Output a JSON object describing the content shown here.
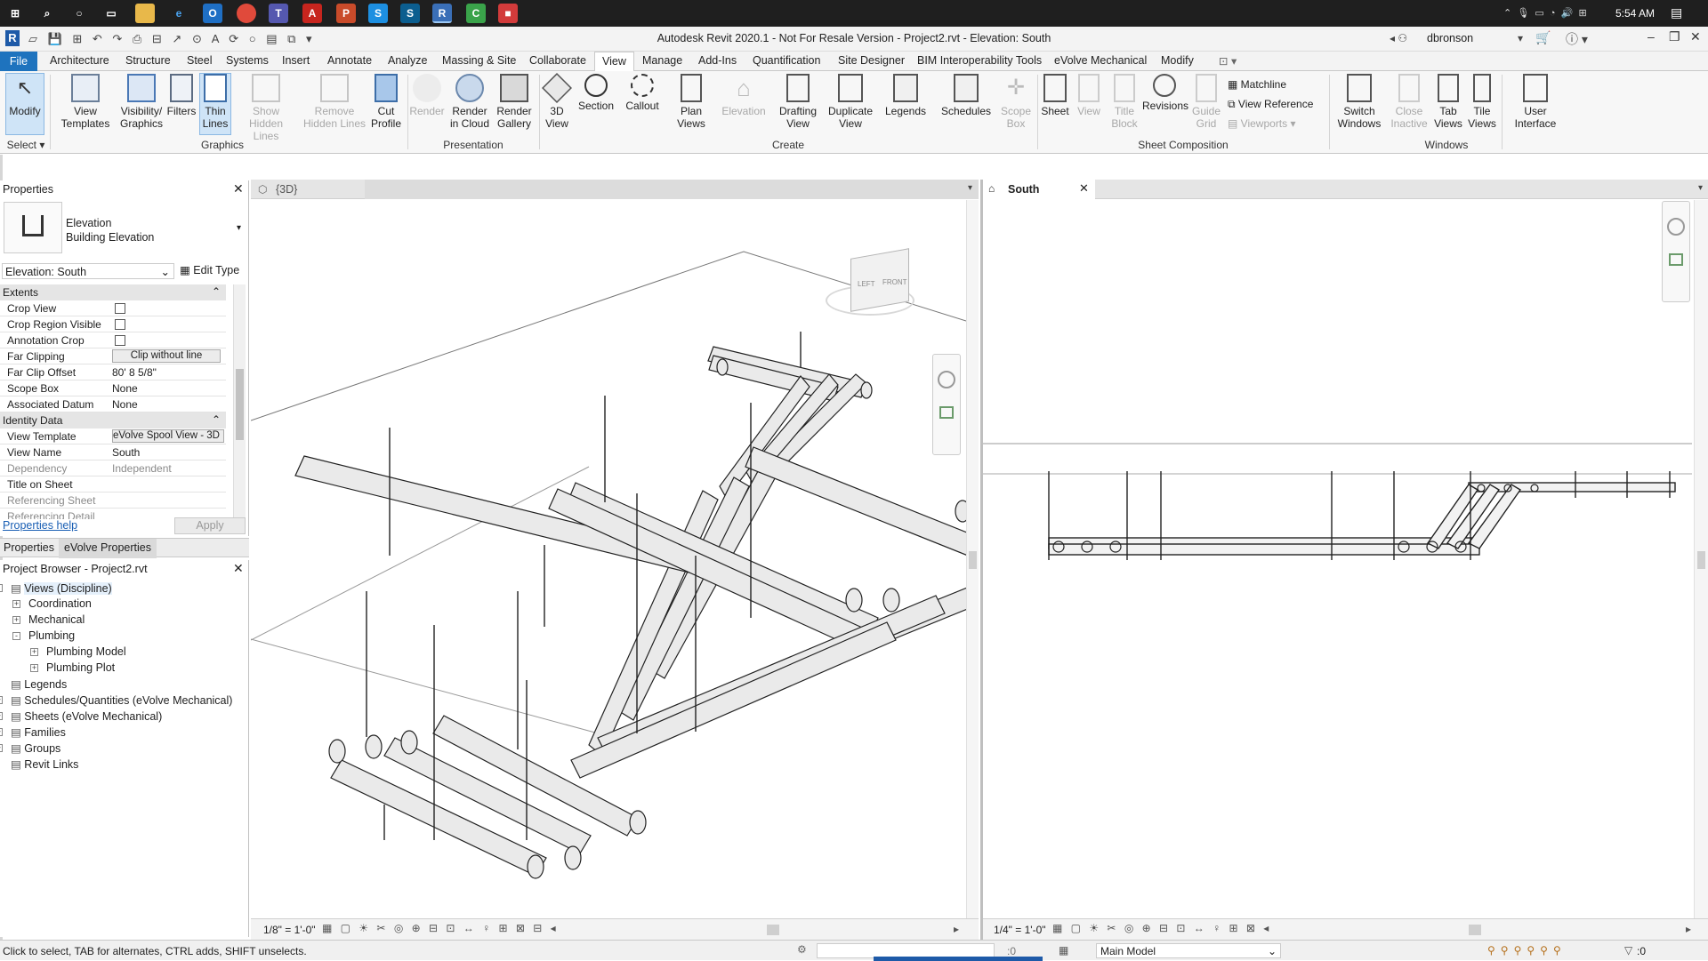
{
  "taskbar": {
    "time": "5:54 AM"
  },
  "window": {
    "title": "Autodesk Revit 2020.1 - Not For Resale Version - Project2.rvt - Elevation: South",
    "user": "dbronson"
  },
  "menu": {
    "file": "File",
    "tabs": [
      "Architecture",
      "Structure",
      "Steel",
      "Systems",
      "Insert",
      "Annotate",
      "Analyze",
      "Massing & Site",
      "Collaborate",
      "View",
      "Manage",
      "Add-Ins",
      "Quantification",
      "Site Designer",
      "BIM Interoperability Tools",
      "eVolve Mechanical",
      "Modify"
    ],
    "active": "View"
  },
  "ribbon": {
    "buttons": [
      {
        "label": "Modify",
        "enabled": true
      },
      {
        "label": "View\nTemplates",
        "enabled": true
      },
      {
        "label": "Visibility/\nGraphics",
        "enabled": true
      },
      {
        "label": "Filters",
        "enabled": true
      },
      {
        "label": "Thin\nLines",
        "enabled": true
      },
      {
        "label": "Show\nHidden Lines",
        "enabled": false
      },
      {
        "label": "Remove\nHidden Lines",
        "enabled": false
      },
      {
        "label": "Cut\nProfile",
        "enabled": true
      },
      {
        "label": "Render",
        "enabled": false
      },
      {
        "label": "Render\nin Cloud",
        "enabled": true
      },
      {
        "label": "Render\nGallery",
        "enabled": true
      },
      {
        "label": "3D\nView",
        "enabled": true
      },
      {
        "label": "Section",
        "enabled": true
      },
      {
        "label": "Callout",
        "enabled": true
      },
      {
        "label": "Plan\nViews",
        "enabled": true
      },
      {
        "label": "Elevation",
        "enabled": false
      },
      {
        "label": "Drafting\nView",
        "enabled": true
      },
      {
        "label": "Duplicate\nView",
        "enabled": true
      },
      {
        "label": "Legends",
        "enabled": true
      },
      {
        "label": "Schedules",
        "enabled": true
      },
      {
        "label": "Scope\nBox",
        "enabled": false
      },
      {
        "label": "Sheet",
        "enabled": true
      },
      {
        "label": "View",
        "enabled": false
      },
      {
        "label": "Title\nBlock",
        "enabled": false
      },
      {
        "label": "Revisions",
        "enabled": true
      },
      {
        "label": "Guide\nGrid",
        "enabled": false
      },
      {
        "label": "Switch\nWindows",
        "enabled": true
      },
      {
        "label": "Close\nInactive",
        "enabled": false
      },
      {
        "label": "Tab\nViews",
        "enabled": true
      },
      {
        "label": "Tile\nViews",
        "enabled": true
      },
      {
        "label": "User\nInterface",
        "enabled": true
      }
    ],
    "small": [
      "Matchline",
      "View  Reference",
      "Viewports"
    ],
    "panels": [
      "Select",
      "Graphics",
      "Presentation",
      "Create",
      "Sheet Composition",
      "Windows"
    ]
  },
  "properties": {
    "title": "Properties",
    "type_family": "Elevation",
    "type_name": "Building Elevation",
    "selector": "Elevation: South",
    "edit_type": "Edit Type",
    "groups": [
      "Extents",
      "Identity Data"
    ],
    "rows": [
      {
        "k": "Crop View",
        "v": "",
        "cb": true
      },
      {
        "k": "Crop Region Visible",
        "v": "",
        "cb": true
      },
      {
        "k": "Annotation Crop",
        "v": "",
        "cb": true
      },
      {
        "k": "Far Clipping",
        "v": "Clip without line"
      },
      {
        "k": "Far Clip Offset",
        "v": "80'  8 5/8\""
      },
      {
        "k": "Scope Box",
        "v": "None"
      },
      {
        "k": "Associated Datum",
        "v": "None"
      },
      {
        "k": "View Template",
        "v": "eVolve Spool View - 3D"
      },
      {
        "k": "View Name",
        "v": "South"
      },
      {
        "k": "Dependency",
        "v": "Independent"
      },
      {
        "k": "Title on Sheet",
        "v": ""
      },
      {
        "k": "Referencing Sheet",
        "v": ""
      },
      {
        "k": "Referencing Detail",
        "v": ""
      }
    ],
    "help": "Properties help",
    "apply": "Apply",
    "tabs": [
      "Properties",
      "eVolve Properties"
    ]
  },
  "browser": {
    "title": "Project Browser - Project2.rvt",
    "items": [
      {
        "label": "Views (Discipline)",
        "level": 0,
        "exp": "-"
      },
      {
        "label": "Coordination",
        "level": 1,
        "exp": "+"
      },
      {
        "label": "Mechanical",
        "level": 1,
        "exp": "+"
      },
      {
        "label": "Plumbing",
        "level": 1,
        "exp": "-"
      },
      {
        "label": "Plumbing Model",
        "level": 2,
        "exp": "+"
      },
      {
        "label": "Plumbing Plot",
        "level": 2,
        "exp": "+"
      },
      {
        "label": "Legends",
        "level": 0,
        "exp": ""
      },
      {
        "label": "Schedules/Quantities (eVolve Mechanical)",
        "level": 0,
        "exp": "+"
      },
      {
        "label": "Sheets (eVolve Mechanical)",
        "level": 0,
        "exp": "+"
      },
      {
        "label": "Families",
        "level": 0,
        "exp": "+"
      },
      {
        "label": "Groups",
        "level": 0,
        "exp": "+"
      },
      {
        "label": "Revit Links",
        "level": 0,
        "exp": ""
      }
    ]
  },
  "views": {
    "left_tab": "{3D}",
    "right_tab": "South",
    "left_scale": "1/8\" = 1'-0\"",
    "right_scale": "1/4\" = 1'-0\""
  },
  "viewcube": {
    "left": "LEFT",
    "front": "FRONT"
  },
  "status": {
    "hint": "Click to select, TAB for alternates, CTRL adds, SHIFT unselects.",
    "zero1": ":0",
    "model": "Main Model",
    "zero2": ":0"
  }
}
